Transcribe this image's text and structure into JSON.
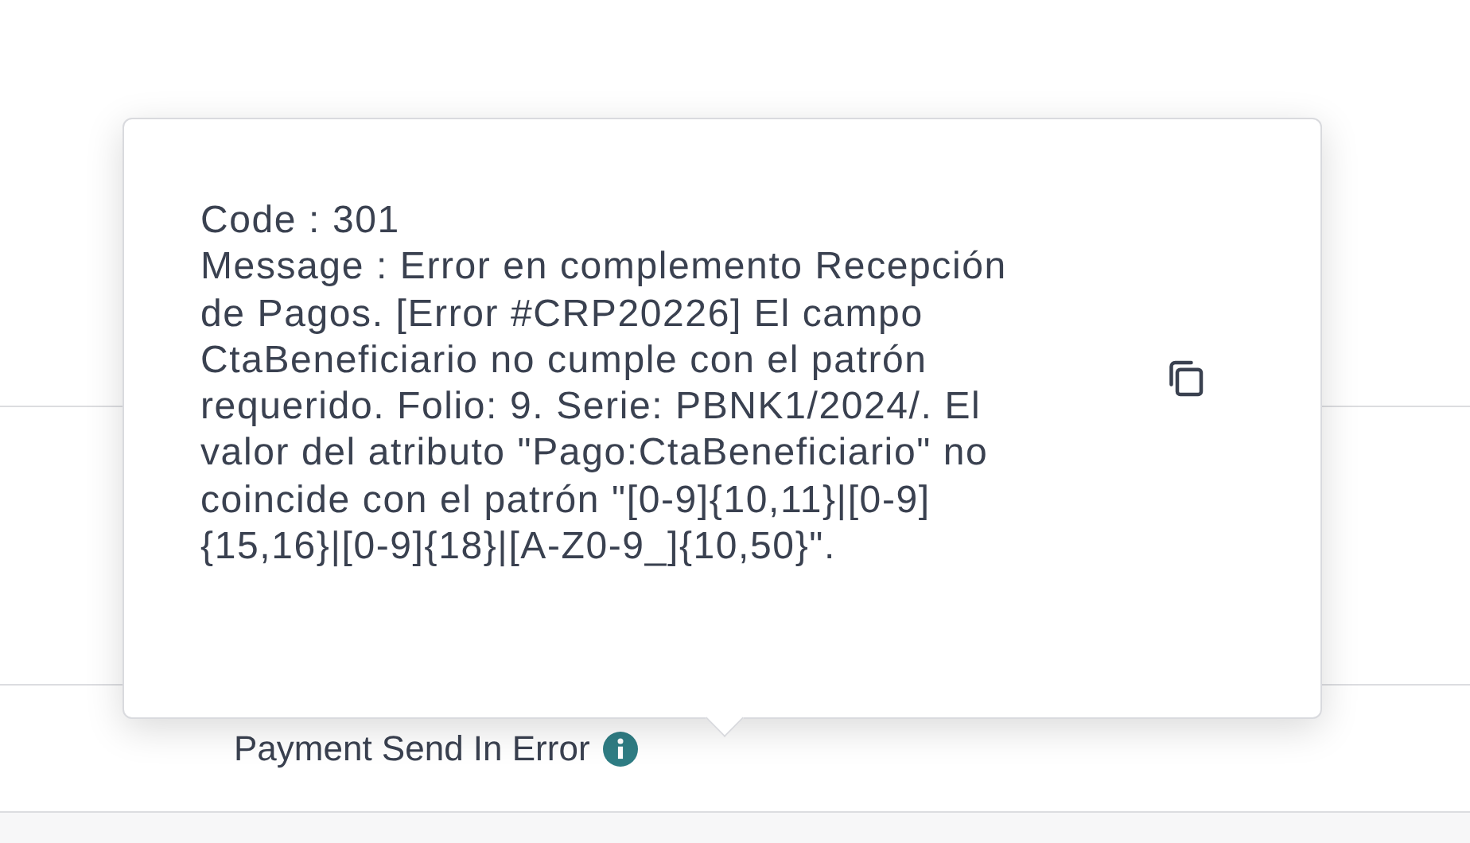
{
  "popover": {
    "code_line": "Code : 301",
    "message": "Message : Error en complemento Recepción de Pagos. [Error #CRP20226] El campo CtaBeneficiario no cumple con el patrón requerido. Folio: 9. Serie: PBNK1/2024/. El valor del atributo \"Pago:CtaBeneficiario\" no coincide con el patrón \"[0-9]{10,11}|[0-9]{15,16}|[0-9]{18}|[A-Z0-9_]{10,50}\"."
  },
  "status": {
    "label": "Payment Send In Error"
  }
}
